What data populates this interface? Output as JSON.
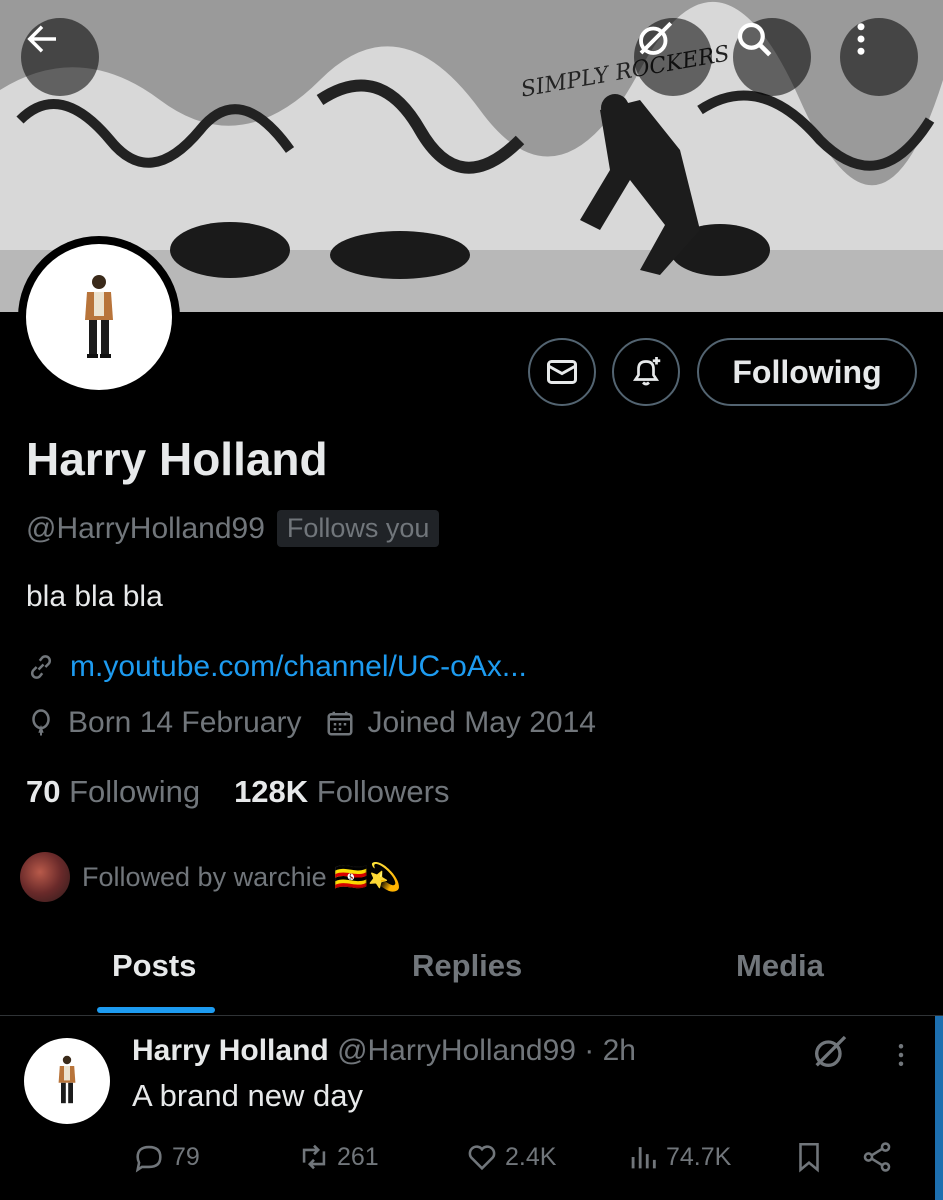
{
  "banner": {
    "graffiti_text": "SIMPLY ROCKERS"
  },
  "top_bar": {
    "back_icon": "arrow-left-icon",
    "grok_icon": "grok-icon",
    "search_icon": "search-icon",
    "more_icon": "more-vertical-icon"
  },
  "profile": {
    "name": "Harry Holland",
    "handle": "@HarryHolland99",
    "follows_you": "Follows you",
    "bio": "bla bla bla",
    "link": "m.youtube.com/channel/UC-oAx...",
    "born": "Born 14 February",
    "joined": "Joined May 2014",
    "following_count": "70",
    "following_label": "Following",
    "followers_count": "128K",
    "followers_label": "Followers",
    "followed_by": "Followed by warchie 🇺🇬💫"
  },
  "actions": {
    "following_button": "Following",
    "message_icon": "envelope-icon",
    "notify_icon": "bell-plus-icon"
  },
  "tabs": [
    {
      "label": "Posts",
      "active": true
    },
    {
      "label": "Replies",
      "active": false
    },
    {
      "label": "Media",
      "active": false
    }
  ],
  "post": {
    "name": "Harry Holland",
    "handle_time": "@HarryHolland99 · 2h",
    "text": "A brand new day",
    "replies": "79",
    "reposts": "261",
    "likes": "2.4K",
    "views": "74.7K"
  },
  "colors": {
    "accent": "#1d9bf0",
    "muted": "#71767b",
    "text": "#e7e9ea",
    "border": "#536471"
  }
}
